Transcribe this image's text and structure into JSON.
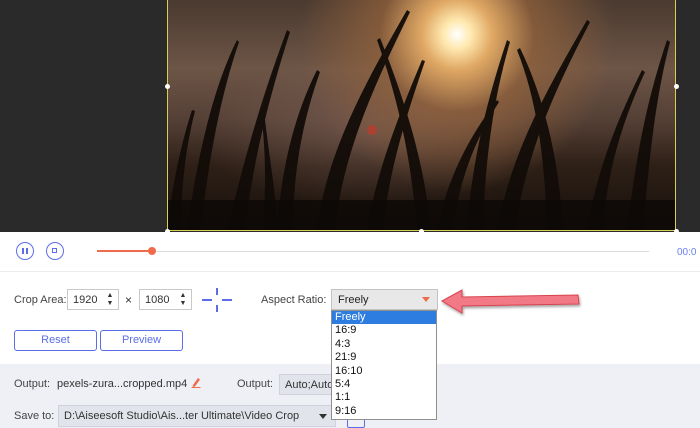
{
  "playback": {
    "time_text": "00:0",
    "progress": 0.1
  },
  "crop": {
    "label": "Crop Area:",
    "width": "1920",
    "height": "1080",
    "times_symbol": "×",
    "spin_up": "▲",
    "spin_down": "▼"
  },
  "aspect": {
    "label": "Aspect Ratio:",
    "selected": "Freely",
    "options": [
      "Freely",
      "16:9",
      "4:3",
      "21:9",
      "16:10",
      "5:4",
      "1:1",
      "9:16"
    ]
  },
  "buttons": {
    "reset": "Reset",
    "preview": "Preview"
  },
  "output": {
    "label": "Output:",
    "file_name": "pexels-zura...cropped.mp4",
    "format_label": "Output:",
    "format_value": "Auto;Auto"
  },
  "save": {
    "label": "Save to:",
    "path": "D:\\Aiseesoft Studio\\Ais...ter Ultimate\\Video Crop"
  },
  "colors": {
    "accent": "#5b6ee8",
    "progress": "#f06b4a",
    "highlight": "#2d7de0",
    "callout": "#f27a86"
  },
  "icons": {
    "pause": "pause-icon",
    "stop": "stop-icon",
    "center": "crosshair-center-icon",
    "edit": "pencil-icon",
    "folder": "folder-icon"
  }
}
